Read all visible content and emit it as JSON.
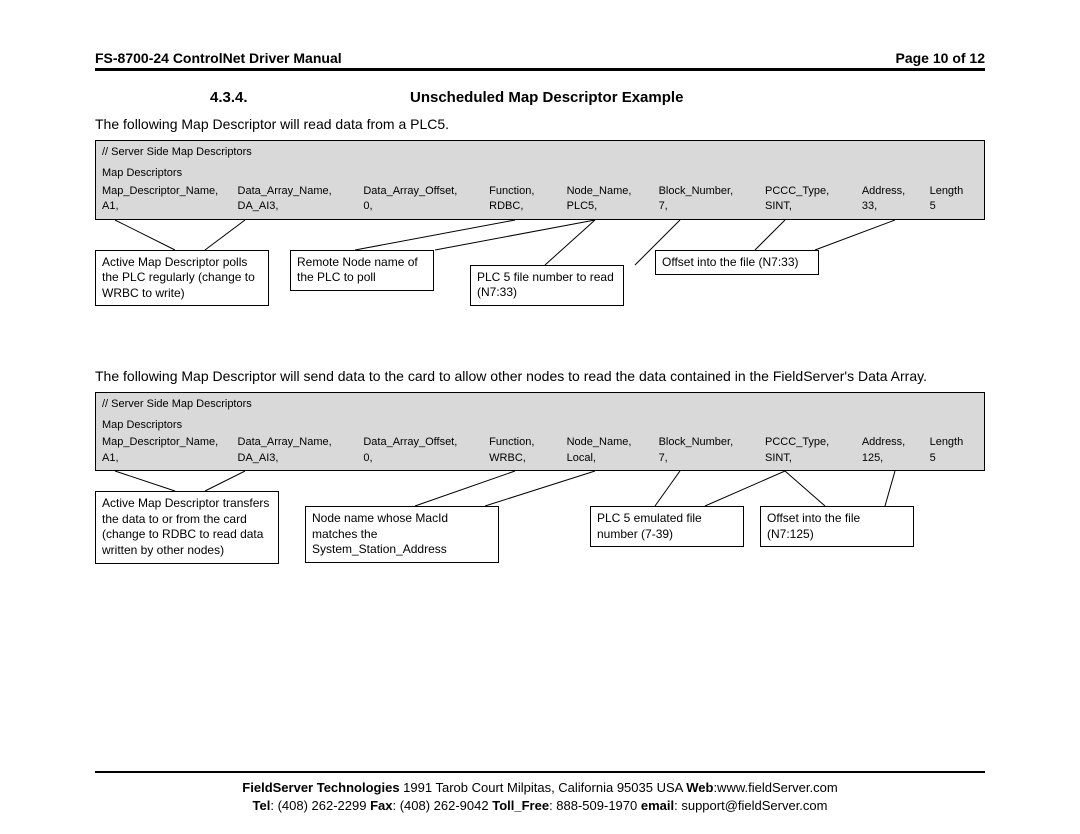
{
  "header": {
    "left": "FS-8700-24 ControlNet Driver Manual",
    "right": "Page 10 of 12"
  },
  "section": {
    "num": "4.3.4.",
    "title": "Unscheduled Map Descriptor Example"
  },
  "intro1": "The following Map Descriptor will read data from a PLC5.",
  "intro2": "The following Map Descriptor will send data to the card to allow other nodes to read the data contained in the FieldServer's Data Array.",
  "code1": {
    "comment": "//    Server Side Map Descriptors",
    "label": "Map Descriptors",
    "headers": [
      "Map_Descriptor_Name,",
      "Data_Array_Name,",
      "Data_Array_Offset,",
      "Function,",
      "Node_Name,",
      "Block_Number,",
      "PCCC_Type,",
      "Address,",
      "Length"
    ],
    "values": [
      "A1,",
      "DA_AI3,",
      "0,",
      "RDBC,",
      "PLC5,",
      "7,",
      "SINT,",
      "33,",
      "5"
    ]
  },
  "code2": {
    "comment": "//    Server Side Map Descriptors",
    "label": "Map Descriptors",
    "headers": [
      "Map_Descriptor_Name,",
      "Data_Array_Name,",
      "Data_Array_Offset,",
      "Function,",
      "Node_Name,",
      "Block_Number,",
      "PCCC_Type,",
      "Address,",
      "Length"
    ],
    "values": [
      "A1,",
      "DA_AI3,",
      "0,",
      "WRBC,",
      "Local,",
      "7,",
      "SINT,",
      "125,",
      "5"
    ]
  },
  "anno1": {
    "a": "Active Map Descriptor polls the PLC regularly (change to WRBC to write)",
    "b": "Remote Node name of the PLC to poll",
    "c": "PLC 5 file number to read (N7:33)",
    "d": "Offset into the file (N7:33)"
  },
  "anno2": {
    "a": "Active Map Descriptor transfers the data to or from the card (change to RDBC to read data written by other nodes)",
    "b": "Node name whose MacId matches the System_Station_Address",
    "c": "PLC 5 emulated file number (7-39)",
    "d": "Offset into the file (N7:125)"
  },
  "footer": {
    "company": "FieldServer Technologies",
    "addr": " 1991 Tarob Court Milpitas, California 95035 USA  ",
    "web_l": "Web",
    "web_v": ":www.fieldServer.com",
    "tel_l": "Tel",
    "tel_v": ": (408) 262-2299  ",
    "fax_l": "Fax",
    "fax_v": ": (408) 262-9042  ",
    "toll_l": "Toll_Free",
    "toll_v": ": 888-509-1970   ",
    "email_l": "email",
    "email_v": ": support@fieldServer.com"
  }
}
